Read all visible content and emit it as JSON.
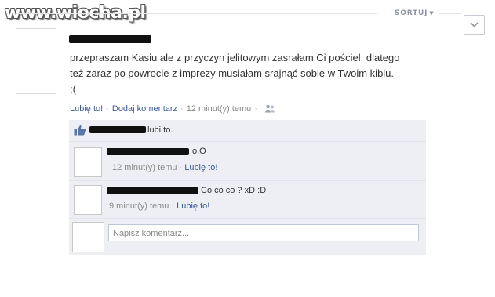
{
  "watermark": "www.wiocha.pl",
  "sort_label": "SORTUJ",
  "post": {
    "text_line1": "przepraszam Kasiu ale z przyczyn jelitowym zasrałam Ci pościel, dlatego",
    "text_line2": "też zaraz po powrocie z imprezy musiałam srajnąć sobie w Twoim kiblu.",
    "text_line3": ";(",
    "like_link": "Lubię to!",
    "comment_link": "Dodaj komentarz",
    "time": "12 minut(y) temu",
    "separator": "·"
  },
  "likes": {
    "text": "lubi to."
  },
  "comments": [
    {
      "text": "o.O",
      "time": "12 minut(y) temu",
      "like": "Lubię to!"
    },
    {
      "text": "Co co co ? xD :D",
      "time": "9 minut(y) temu",
      "like": "Lubię to!"
    }
  ],
  "composer": {
    "placeholder": "Napisz komentarz..."
  },
  "colors": {
    "link": "#3b5998",
    "box_bg": "#edeff4",
    "meta": "#8a8a8a"
  },
  "icons": [
    "chevron-down-icon",
    "friends-icon",
    "thumbs-up-icon"
  ]
}
